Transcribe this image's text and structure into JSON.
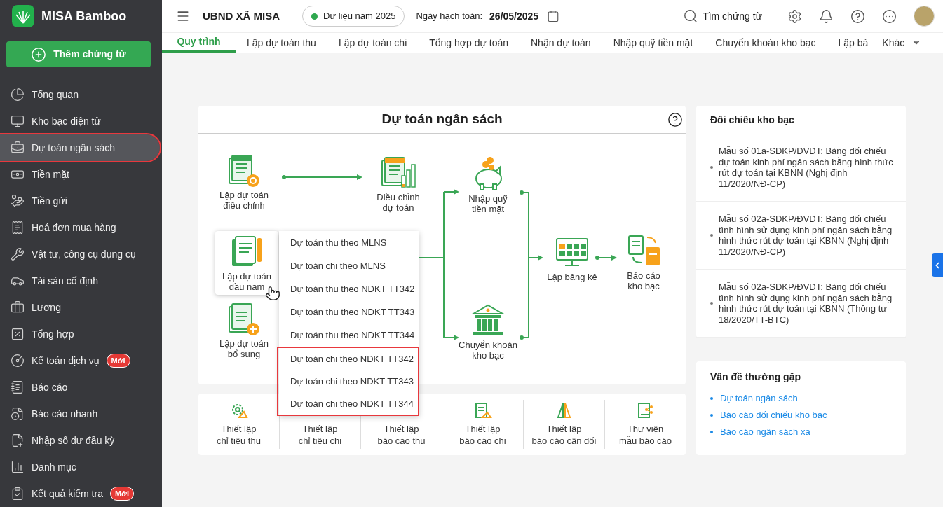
{
  "app": {
    "name": "MISA Bamboo"
  },
  "add_button": {
    "label": "Thêm chứng từ"
  },
  "sidebar": {
    "items": [
      {
        "label": "Tổng quan",
        "selected": false,
        "highlighted": false
      },
      {
        "label": "Kho bạc điện tử",
        "selected": false,
        "highlighted": false
      },
      {
        "label": "Dự toán ngân sách",
        "selected": true,
        "highlighted": true
      },
      {
        "label": "Tiền mặt",
        "selected": false,
        "highlighted": false
      },
      {
        "label": "Tiền gửi",
        "selected": false,
        "highlighted": false
      },
      {
        "label": "Hoá đơn mua hàng",
        "selected": false,
        "highlighted": false
      },
      {
        "label": "Vật tư, công cụ dụng cụ",
        "selected": false,
        "highlighted": false
      },
      {
        "label": "Tài sản cố định",
        "selected": false,
        "highlighted": false
      },
      {
        "label": "Lương",
        "selected": false,
        "highlighted": false
      },
      {
        "label": "Tổng hợp",
        "selected": false,
        "highlighted": false
      },
      {
        "label": "Kế toán dịch vụ",
        "selected": false,
        "highlighted": false,
        "badge": "Mới"
      },
      {
        "label": "Báo cáo",
        "selected": false,
        "highlighted": false
      },
      {
        "label": "Báo cáo nhanh",
        "selected": false,
        "highlighted": false
      },
      {
        "label": "Nhập số dư đầu kỳ",
        "selected": false,
        "highlighted": false
      },
      {
        "label": "Danh mục",
        "selected": false,
        "highlighted": false
      },
      {
        "label": "Kết quả kiểm tra",
        "selected": false,
        "highlighted": false,
        "badge": "Mới"
      }
    ]
  },
  "header": {
    "organization": "UBND XÃ MISA",
    "data_year": "Dữ liệu năm 2025",
    "posting_date_label": "Ngày hạch toán:",
    "posting_date": "26/05/2025",
    "search_label": "Tìm chứng từ"
  },
  "tabs": [
    {
      "label": "Quy trình",
      "selected": true
    },
    {
      "label": "Lập dự toán thu",
      "selected": false
    },
    {
      "label": "Lập dự toán chi",
      "selected": false
    },
    {
      "label": "Tổng hợp dự toán",
      "selected": false
    },
    {
      "label": "Nhận dự toán",
      "selected": false
    },
    {
      "label": "Nhập quỹ tiền mặt",
      "selected": false
    },
    {
      "label": "Chuyển khoản kho bạc",
      "selected": false
    },
    {
      "label": "Lập bả",
      "selected": false
    }
  ],
  "more_tab": {
    "label": "Khác"
  },
  "process": {
    "title": "Dự toán ngân sách",
    "nodes": [
      {
        "label": "Lập dự toán\nđiều chỉnh",
        "kind": "doc_gear",
        "selected": false
      },
      {
        "label": "Điều chỉnh\ndự toán",
        "kind": "doc_chart",
        "selected": false
      },
      {
        "label": "Nhập quỹ\ntiền mặt",
        "kind": "piggy",
        "selected": false
      },
      {
        "label": "Lập dự toán\nđầu năm",
        "kind": "doc_pencil",
        "selected": true
      },
      {
        "label": "Lập dự toán\nbổ sung",
        "kind": "doc_plus",
        "selected": false
      },
      {
        "label": "Chuyển khoản\nkho bạc",
        "kind": "bank",
        "selected": false
      },
      {
        "label": "Lập bảng kê",
        "kind": "monitor_grid",
        "selected": false
      },
      {
        "label": "Báo cáo\nkho bạc",
        "kind": "docs_exchange",
        "selected": false
      }
    ],
    "menu": [
      {
        "label": "Dự toán thu theo MLNS",
        "highlighted": false
      },
      {
        "label": "Dự toán chi theo MLNS",
        "highlighted": false
      },
      {
        "label": "Dự toán thu theo NDKT TT342",
        "highlighted": false
      },
      {
        "label": "Dự toán thu theo NDKT TT343",
        "highlighted": false
      },
      {
        "label": "Dự toán thu theo NDKT TT344",
        "highlighted": false
      },
      {
        "label": "Dự toán chi theo NDKT TT342",
        "highlighted": true
      },
      {
        "label": "Dự toán chi theo NDKT TT343",
        "highlighted": true
      },
      {
        "label": "Dự toán chi theo NDKT TT344",
        "highlighted": true
      }
    ]
  },
  "settings": [
    {
      "label": "Thiết lập\nchỉ tiêu thu",
      "kind": "gear"
    },
    {
      "label": "Thiết lập\nchỉ tiêu chi"
    },
    {
      "label": "Thiết lập\nbáo cáo thu"
    },
    {
      "label": "Thiết lập\nbáo cáo chi",
      "kind": "doc"
    },
    {
      "label": "Thiết lập\nbáo cáo cân đối",
      "kind": "balance"
    },
    {
      "label": "Thư viện\nmẫu báo cáo",
      "kind": "library"
    }
  ],
  "reconciliation": {
    "title": "Đối chiếu kho bạc",
    "items": [
      "Mẫu số 01a-SDKP/ĐVDT: Bảng đối chiếu dự toán kinh phí ngân sách bằng hình thức rút dự toán tại KBNN (Nghị định 11/2020/NĐ-CP)",
      "Mẫu số 02a-SDKP/ĐVDT: Bảng đối chiếu tình hình sử dụng kinh phí ngân sách bằng hình thức rút dự toán tại KBNN (Nghị định 11/2020/NĐ-CP)",
      "Mẫu số 02a-SDKP/ĐVDT: Bảng đối chiếu tình hình sử dụng kinh phí ngân sách bằng hình thức rút dự toán tại KBNN (Thông tư 18/2020/TT-BTC)"
    ]
  },
  "faq": {
    "title": "Vấn đề thường gặp",
    "links": [
      "Dự toán ngân sách",
      "Báo cáo đối chiếu kho bạc",
      "Báo cáo ngân sách xã"
    ]
  }
}
